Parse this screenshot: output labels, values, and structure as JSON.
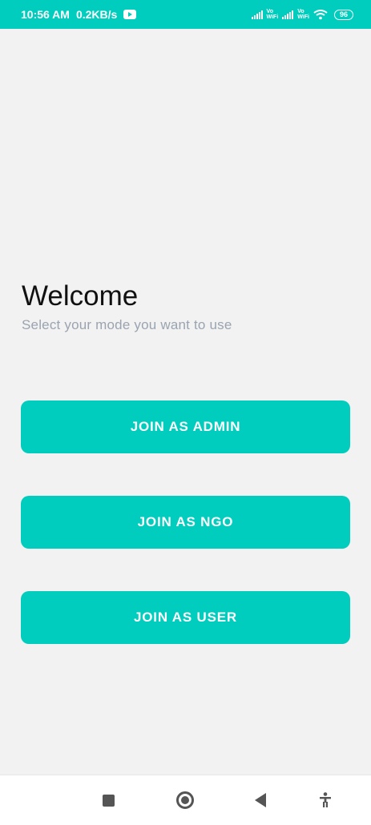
{
  "status_bar": {
    "time": "10:56 AM",
    "speed": "0.2KB/s",
    "vo_label": "Vo",
    "wifi_label": "WiFi",
    "battery": "96",
    "icons": [
      "youtube-icon",
      "signal-icon",
      "wifi-icon",
      "battery-icon"
    ]
  },
  "main": {
    "title": "Welcome",
    "subtitle": "Select your mode you want to use",
    "buttons": [
      {
        "label": "JOIN AS ADMIN"
      },
      {
        "label": "JOIN AS NGO"
      },
      {
        "label": "JOIN AS USER"
      }
    ]
  },
  "nav_bar": {
    "icons": [
      "recents-icon",
      "home-icon",
      "back-icon",
      "accessibility-icon"
    ]
  },
  "colors": {
    "accent": "#00cdbd",
    "background": "#f2f2f2",
    "subtitle": "#9aa4b0"
  }
}
